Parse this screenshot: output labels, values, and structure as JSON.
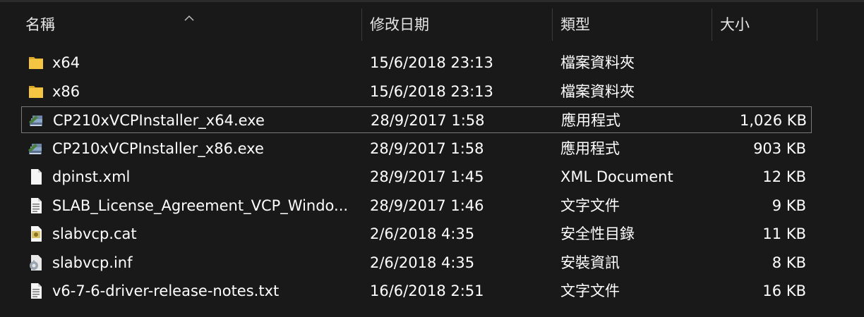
{
  "columns": {
    "name": "名稱",
    "date": "修改日期",
    "type": "類型",
    "size": "大小"
  },
  "files": [
    {
      "name": "x64",
      "date": "15/6/2018 23:13",
      "type": "檔案資料夾",
      "size": "",
      "icon": "folder-icon"
    },
    {
      "name": "x86",
      "date": "15/6/2018 23:13",
      "type": "檔案資料夾",
      "size": "",
      "icon": "folder-icon"
    },
    {
      "name": "CP210xVCPInstaller_x64.exe",
      "date": "28/9/2017 1:58",
      "type": "應用程式",
      "size": "1,026 KB",
      "icon": "installer-icon"
    },
    {
      "name": "CP210xVCPInstaller_x86.exe",
      "date": "28/9/2017 1:58",
      "type": "應用程式",
      "size": "903 KB",
      "icon": "installer-icon"
    },
    {
      "name": "dpinst.xml",
      "date": "28/9/2017 1:45",
      "type": "XML Document",
      "size": "12 KB",
      "icon": "document-icon"
    },
    {
      "name": "SLAB_License_Agreement_VCP_Windo...",
      "date": "28/9/2017 1:46",
      "type": "文字文件",
      "size": "9 KB",
      "icon": "text-file-icon"
    },
    {
      "name": "slabvcp.cat",
      "date": "2/6/2018 4:35",
      "type": "安全性目錄",
      "size": "11 KB",
      "icon": "security-catalog-icon"
    },
    {
      "name": "slabvcp.inf",
      "date": "2/6/2018 4:35",
      "type": "安裝資訊",
      "size": "8 KB",
      "icon": "setup-info-icon"
    },
    {
      "name": "v6-7-6-driver-release-notes.txt",
      "date": "16/6/2018 2:51",
      "type": "文字文件",
      "size": "16 KB",
      "icon": "text-file-icon"
    }
  ],
  "colors": {
    "background": "#191919",
    "folder": "#f4c542",
    "focus_border": "#7a7a7a"
  }
}
